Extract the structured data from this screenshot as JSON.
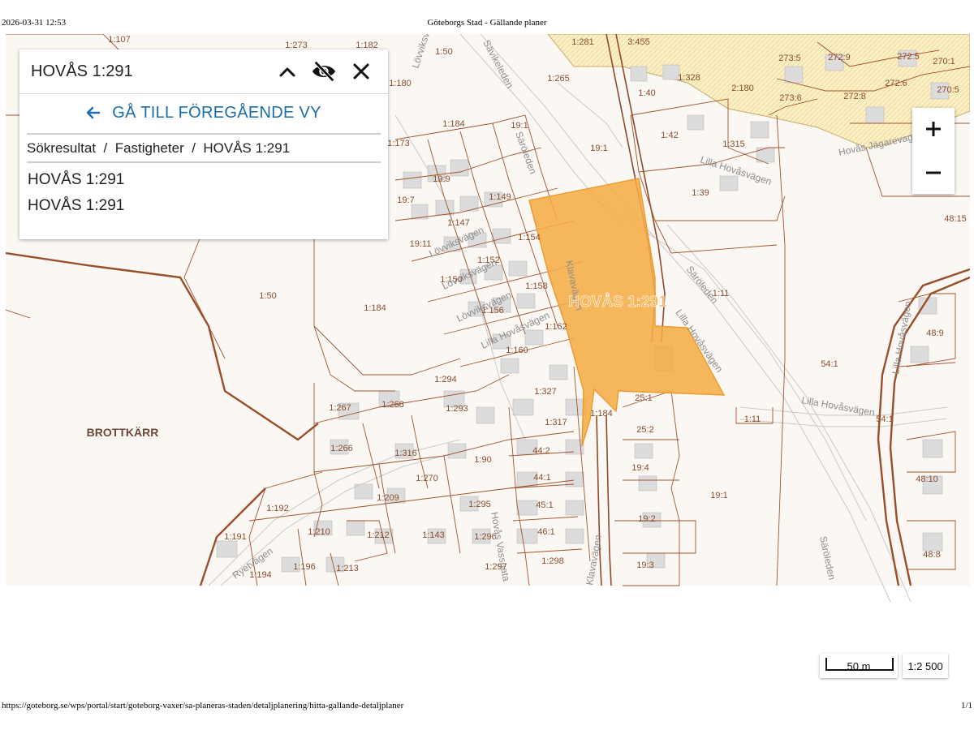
{
  "print": {
    "timestamp": "2026-03-31 12:53",
    "page_title": "Göteborgs Stad - Gällande planer",
    "url": "https://goteborg.se/wps/portal/start/goteborg-vaxer/sa-planeras-staden/detaljplanering/hitta-gallande-detaljplaner",
    "page_number": "1/1"
  },
  "panel": {
    "title": "HOVÅS 1:291",
    "back_label": "GÅ TILL FÖREGÅENDE VY",
    "breadcrumb": [
      "Sökresultat",
      "Fastigheter",
      "HOVÅS 1:291"
    ],
    "breadcrumb_separator": "/",
    "results": [
      "HOVÅS 1:291",
      "HOVÅS 1:291"
    ]
  },
  "zoom": {
    "in_label": "+",
    "out_label": "−"
  },
  "scale": {
    "bar_label": "50 m",
    "ratio": "1:2 500"
  },
  "colors": {
    "parcel_line": "#a0532d",
    "highlight": "#f5ac45",
    "plan_area": "#fbefc4",
    "link": "#1a6fa8"
  },
  "map": {
    "highlight_label": "HOVÅS 1:291",
    "district_label": "BROTTKÄRR",
    "roads": [
      "Sävikeleden",
      "Lövviksvägen",
      "Säröleden",
      "Lilla Hovåsvägen",
      "Klavavägen",
      "Lövviksvägen",
      "Lövviksvägen",
      "Lövviksvägen",
      "Lilla Hovåsvägen",
      "Säröleden",
      "Hovås Jägarevag",
      "Lilla Hovåsvägen",
      "Lilla Hovåsvägen",
      "Lilla Hovåsvägen",
      "Ryetvägen",
      "Hovås Vassgata",
      "Klavavägen",
      "Säröleden"
    ],
    "parcels": [
      "1:107",
      "1:273",
      "1:182",
      "1:50",
      "1:180",
      "1:184",
      "1:173",
      "1:265",
      "1:281",
      "3:455",
      "1:40",
      "1:328",
      "2:180",
      "273:5",
      "272:9",
      "272:5",
      "270:1",
      "272:6",
      "270:5",
      "273:6",
      "272:8",
      "19:1",
      "19:1",
      "1:42",
      "1:315",
      "1:39",
      "19:9",
      "19:7",
      "1:149",
      "1:147",
      "19:11",
      "1:154",
      "1:152",
      "1:150",
      "1:158",
      "1:156",
      "1:162",
      "1:160",
      "1:50",
      "1:184",
      "1:11",
      "48:15",
      "48:9",
      "54:1",
      "1:294",
      "1:267",
      "1:268",
      "1:293",
      "1:327",
      "25:1",
      "1:184",
      "1:317",
      "25:2",
      "1:11",
      "54:1",
      "1:266",
      "1:316",
      "1:90",
      "44:2",
      "1:270",
      "44:1",
      "19:4",
      "48:10",
      "1:209",
      "1:192",
      "1:295",
      "45:1",
      "19:1",
      "1:210",
      "1:212",
      "1:143",
      "1:296",
      "46:1",
      "19:2",
      "1:191",
      "1:196",
      "1:213",
      "1:194",
      "1:297",
      "1:298",
      "19:3",
      "48:8"
    ]
  }
}
